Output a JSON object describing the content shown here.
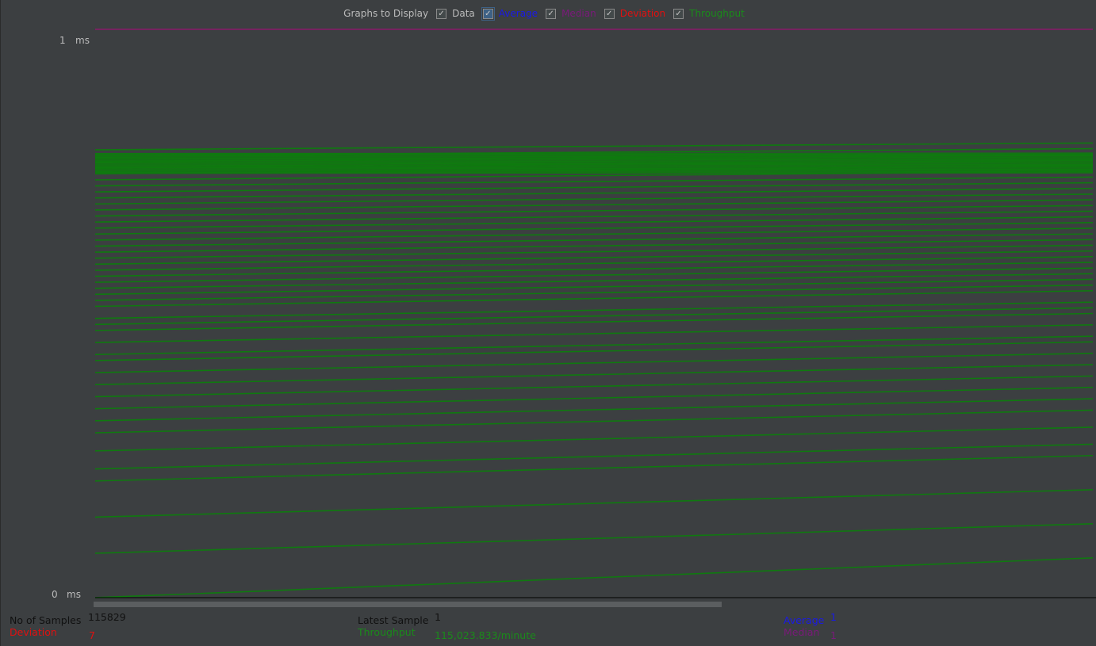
{
  "toolbar": {
    "label": "Graphs to Display",
    "checkboxes": [
      {
        "label": "Data",
        "checked": true,
        "color": "#bbbbbb"
      },
      {
        "label": "Average",
        "checked": true,
        "color": "#1a1ae6"
      },
      {
        "label": "Median",
        "checked": true,
        "color": "#7a1a7a"
      },
      {
        "label": "Deviation",
        "checked": true,
        "color": "#e01010"
      },
      {
        "label": "Throughput",
        "checked": true,
        "color": "#1a8a1a"
      }
    ]
  },
  "axis": {
    "y_max_value": "1",
    "y_max_unit": "ms",
    "y_min_value": "0",
    "y_min_unit": "ms"
  },
  "stats": {
    "samples_label": "No of Samples",
    "samples_value": "115829",
    "deviation_label": "Deviation",
    "deviation_value": "7",
    "latest_label": "Latest Sample",
    "latest_value": "1",
    "throughput_label": "Throughput",
    "throughput_value": "115,023.833/minute",
    "average_label": "Average",
    "average_value": "1",
    "median_label": "Median",
    "median_value": "1"
  },
  "colors": {
    "background": "#3c3f41",
    "throughput": "#0f7a0f",
    "median": "#8a1a6a",
    "axis": "#000000"
  },
  "chart_data": {
    "type": "line",
    "ylim": [
      0,
      1
    ],
    "yunit": "ms",
    "series": [
      {
        "name": "Median",
        "values": [
          1,
          1
        ]
      },
      {
        "name": "Throughput",
        "note_values": "many throughput trace lines between 0.07 and 0.8 ms scale",
        "values": [
          0.07,
          0.13,
          0.19,
          0.25,
          0.27,
          0.3,
          0.33,
          0.35,
          0.37,
          0.39,
          0.41,
          0.43,
          0.45,
          0.46,
          0.48,
          0.5,
          0.51,
          0.52,
          0.54,
          0.55,
          0.56,
          0.57,
          0.58,
          0.59,
          0.6,
          0.61,
          0.62,
          0.63,
          0.64,
          0.65,
          0.66,
          0.67,
          0.68,
          0.69,
          0.7,
          0.71,
          0.72,
          0.73,
          0.74,
          0.75,
          0.76,
          0.77,
          0.78,
          0.79,
          0.8
        ]
      }
    ]
  }
}
